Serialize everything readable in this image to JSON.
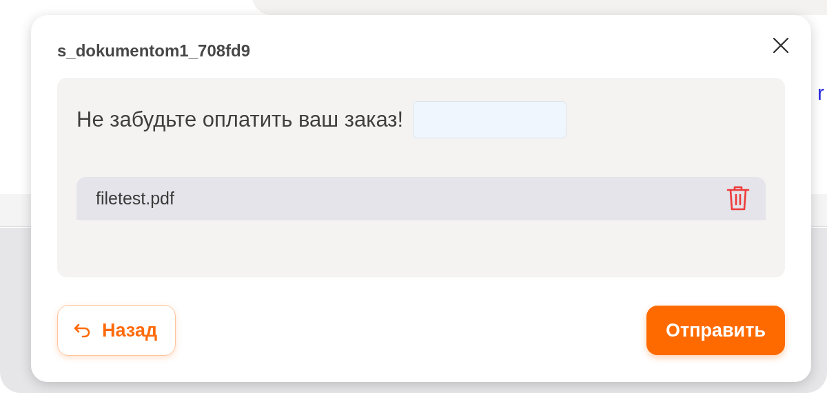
{
  "background": {
    "link_fragment": "r"
  },
  "dialog": {
    "title": "s_dokumentom1_708fd9",
    "message": "Не забудьте оплатить ваш заказ!",
    "attachments": [
      {
        "name": "filetest.pdf"
      }
    ],
    "buttons": [
      {
        "kind": "back",
        "label": "Назад"
      },
      {
        "kind": "primary",
        "label": "Отправить"
      }
    ]
  }
}
